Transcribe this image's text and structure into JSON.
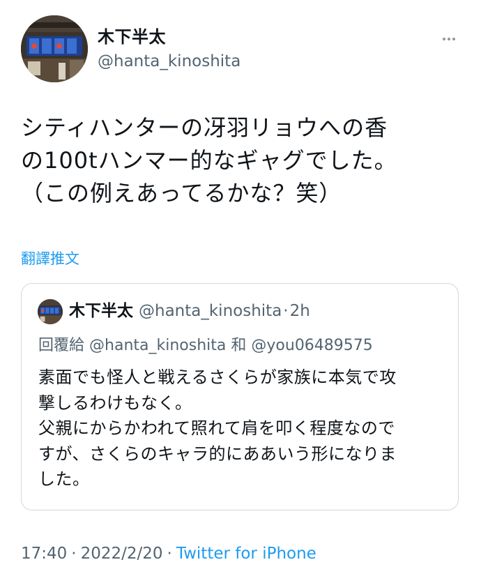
{
  "author": {
    "name": "木下半太",
    "handle": "@hanta_kinoshita"
  },
  "tweet": {
    "lines": [
      "シティハンターの冴羽リョウへの香",
      "の100tハンマー的なギャグでした。",
      "（この例えあってるかな？笑）"
    ]
  },
  "translate_label": "翻譯推文",
  "quote": {
    "name": "木下半太",
    "handle": "@hanta_kinoshita",
    "separator": "·",
    "time": "2h",
    "reply_prefix": "回覆給",
    "reply_to_1": "@hanta_kinoshita",
    "reply_and": "和",
    "reply_to_2": "@you06489575",
    "lines": [
      "素面でも怪人と戦えるさくらが家族に本気で攻",
      "撃しるわけもなく。",
      "父親にからかわれて照れて肩を叩く程度なので",
      "すが、さくらのキャラ的にああいう形になりま",
      "した。"
    ]
  },
  "meta": {
    "time": "17:40",
    "separator": "·",
    "date": "2022/2/20",
    "source": "Twitter for iPhone"
  },
  "colors": {
    "text_primary": "#0f1419",
    "text_secondary": "#536471",
    "link": "#1d9bf0",
    "border": "#cfd9de"
  },
  "icons": {
    "more": "more-horizontal-icon"
  }
}
